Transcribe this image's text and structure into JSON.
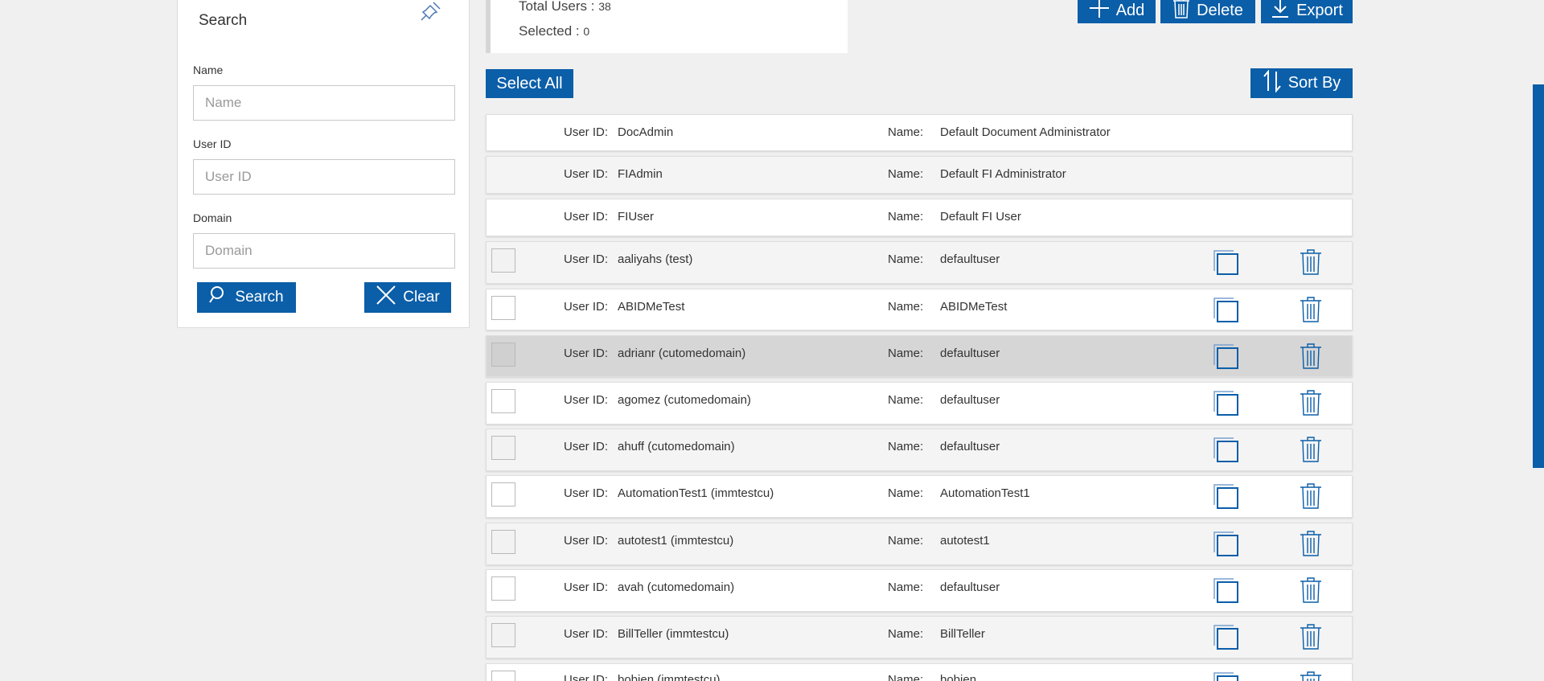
{
  "search_panel": {
    "title": "Search",
    "name_label": "Name",
    "name_placeholder": "Name",
    "userid_label": "User ID",
    "userid_placeholder": "User ID",
    "domain_label": "Domain",
    "domain_placeholder": "Domain",
    "search_button": "Search",
    "clear_button": "Clear"
  },
  "summary": {
    "total_label": "Total Users :",
    "total_value": "38",
    "selected_label": "Selected :",
    "selected_value": "0"
  },
  "toolbar": {
    "add_label": "Add",
    "delete_label": "Delete",
    "export_label": "Export",
    "select_all_label": "Select All",
    "sort_by_label": "Sort By"
  },
  "list": {
    "userid_label": "User ID:",
    "name_label": "Name:",
    "rows": [
      {
        "user_id": "DocAdmin",
        "name": "Default Document Administrator"
      },
      {
        "user_id": "FIAdmin",
        "name": "Default FI Administrator"
      },
      {
        "user_id": "FIUser",
        "name": "Default FI User"
      },
      {
        "user_id": "aaliyahs (test)",
        "name": "defaultuser"
      },
      {
        "user_id": "ABIDMeTest",
        "name": "ABIDMeTest"
      },
      {
        "user_id": "adrianr (cutomedomain)",
        "name": "defaultuser"
      },
      {
        "user_id": "agomez (cutomedomain)",
        "name": "defaultuser"
      },
      {
        "user_id": "ahuff (cutomedomain)",
        "name": "defaultuser"
      },
      {
        "user_id": "AutomationTest1 (immtestcu)",
        "name": "AutomationTest1"
      },
      {
        "user_id": "autotest1 (immtestcu)",
        "name": "autotest1"
      },
      {
        "user_id": "avah (cutomedomain)",
        "name": "defaultuser"
      },
      {
        "user_id": "BillTeller (immtestcu)",
        "name": "BillTeller"
      },
      {
        "user_id": "bobien (immtestcu)",
        "name": "bobien"
      }
    ]
  },
  "colors": {
    "accent": "#0b5ea8",
    "background": "#f0f0f0"
  }
}
